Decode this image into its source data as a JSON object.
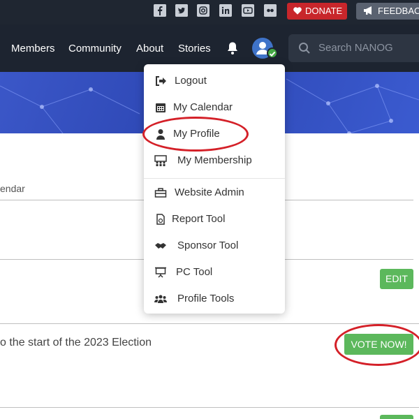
{
  "topbar": {
    "social_icons": [
      "facebook-icon",
      "twitter-icon",
      "instagram-icon",
      "linkedin-icon",
      "youtube-icon",
      "flickr-icon"
    ],
    "donate_label": "DONATE",
    "feedback_label": "FEEDBACK"
  },
  "nav": {
    "items": [
      "Members",
      "Community",
      "About",
      "Stories"
    ],
    "search_placeholder": "Search NANOG"
  },
  "content": {
    "calendar_fragment": "endar",
    "election_text": "o the start of the 2023 Election",
    "edit_label": "EDIT",
    "vote_label": "VOTE NOW!"
  },
  "menu": {
    "items": [
      {
        "label": "Logout",
        "icon": "logout-icon"
      },
      {
        "label": "My Calendar",
        "icon": "calendar-icon"
      },
      {
        "label": "My Profile",
        "icon": "user-icon"
      },
      {
        "label": "My Membership",
        "icon": "membership-icon"
      },
      {
        "label": "Website Admin",
        "icon": "toolbox-icon"
      },
      {
        "label": "Report Tool",
        "icon": "report-icon"
      },
      {
        "label": "Sponsor Tool",
        "icon": "handshake-icon"
      },
      {
        "label": "PC Tool",
        "icon": "presentation-icon"
      },
      {
        "label": "Profile Tools",
        "icon": "users-icon"
      }
    ]
  },
  "colors": {
    "nav_bg": "#1d2430",
    "hero_blue": "#3b57c8",
    "donate_red": "#c8262b",
    "action_green": "#5cb85c",
    "annotation_red": "#d42028"
  }
}
